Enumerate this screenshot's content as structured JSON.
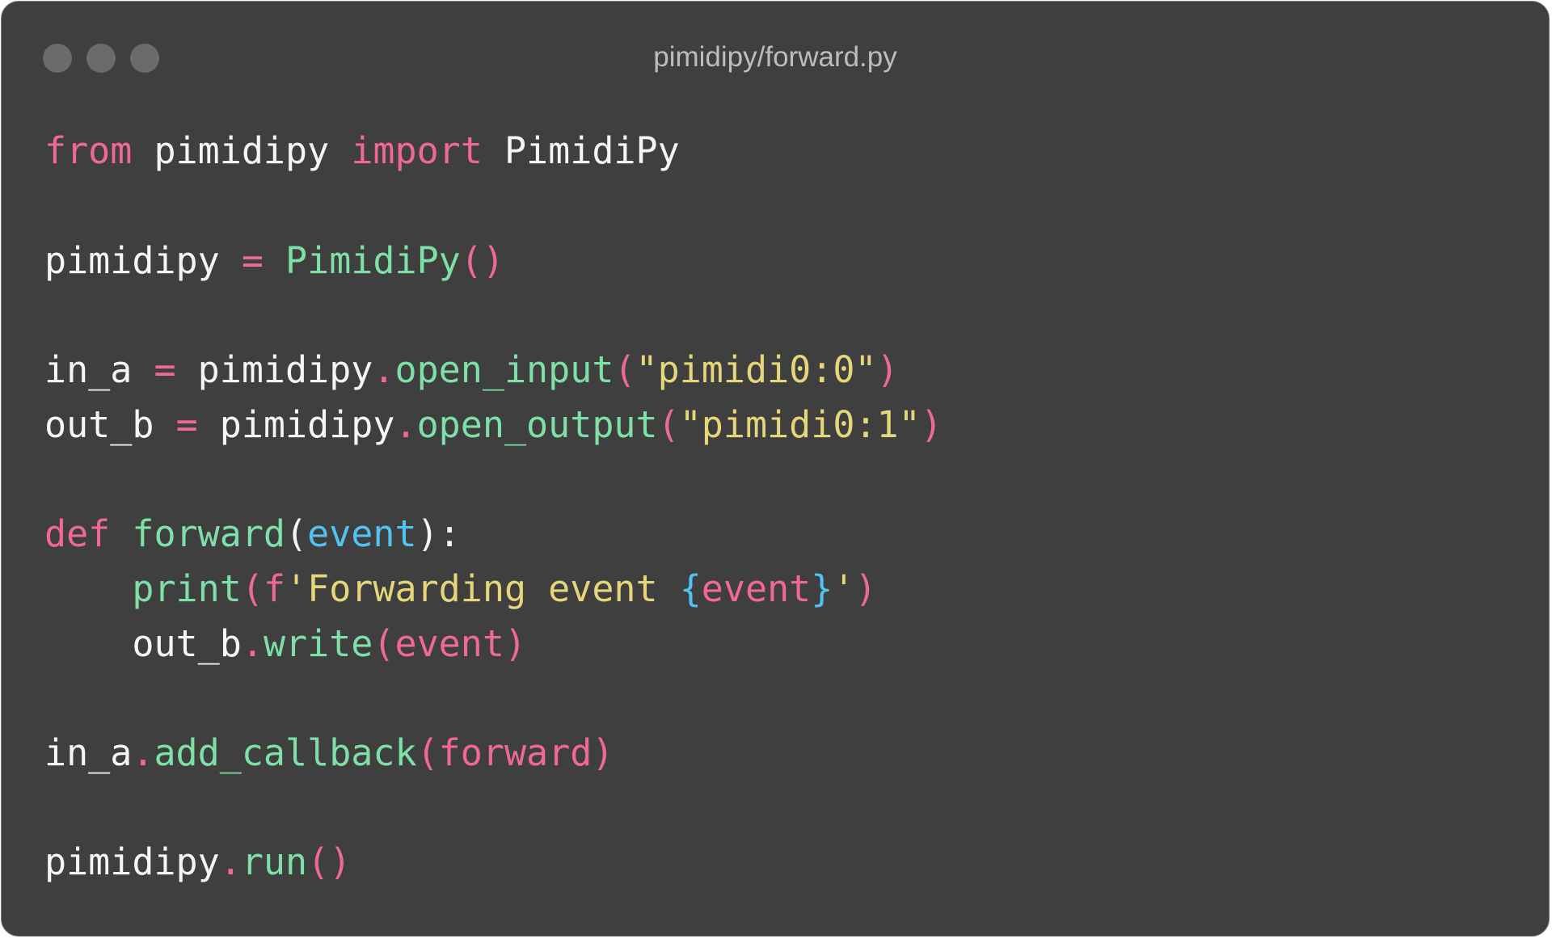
{
  "window": {
    "title": "pimidipy/forward.py",
    "controls": [
      "close",
      "minimize",
      "zoom"
    ]
  },
  "colors": {
    "background": "#3f3f3f",
    "keyword": "#f0679a",
    "function": "#7ee0a6",
    "string": "#e6d67a",
    "parameter": "#4fc3f2",
    "plain": "#f5f5f5",
    "control_dot": "#6b6b6b"
  },
  "code": {
    "l1": {
      "t1": "from",
      "t2": " pimidipy ",
      "t3": "import",
      "t4": " PimidiPy"
    },
    "l3": {
      "t1": "pimidipy ",
      "t2": "=",
      "t3": " ",
      "t4": "PimidiPy",
      "t5": "()"
    },
    "l5": {
      "t1": "in_a ",
      "t2": "=",
      "t3": " pimidipy",
      "t4": ".",
      "t5": "open_input",
      "t6": "(",
      "t7": "\"pimidi0:0\"",
      "t8": ")"
    },
    "l6": {
      "t1": "out_b ",
      "t2": "=",
      "t3": " pimidipy",
      "t4": ".",
      "t5": "open_output",
      "t6": "(",
      "t7": "\"pimidi0:1\"",
      "t8": ")"
    },
    "l8": {
      "t1": "def",
      "t2": " ",
      "t3": "forward",
      "t4": "(",
      "t5": "event",
      "t6": "):"
    },
    "l9": {
      "t0": "    ",
      "t1": "print",
      "t2": "(",
      "t3": "f",
      "t4": "'Forwarding event ",
      "t5": "{",
      "t6": "event",
      "t7": "}",
      "t8": "'",
      "t9": ")"
    },
    "l10": {
      "t0": "    ",
      "t1": "out_b",
      "t2": ".",
      "t3": "write",
      "t4": "(event)"
    },
    "l12": {
      "t1": "in_a",
      "t2": ".",
      "t3": "add_callback",
      "t4": "(forward)"
    },
    "l14": {
      "t1": "pimidipy",
      "t2": ".",
      "t3": "run",
      "t4": "()"
    }
  }
}
